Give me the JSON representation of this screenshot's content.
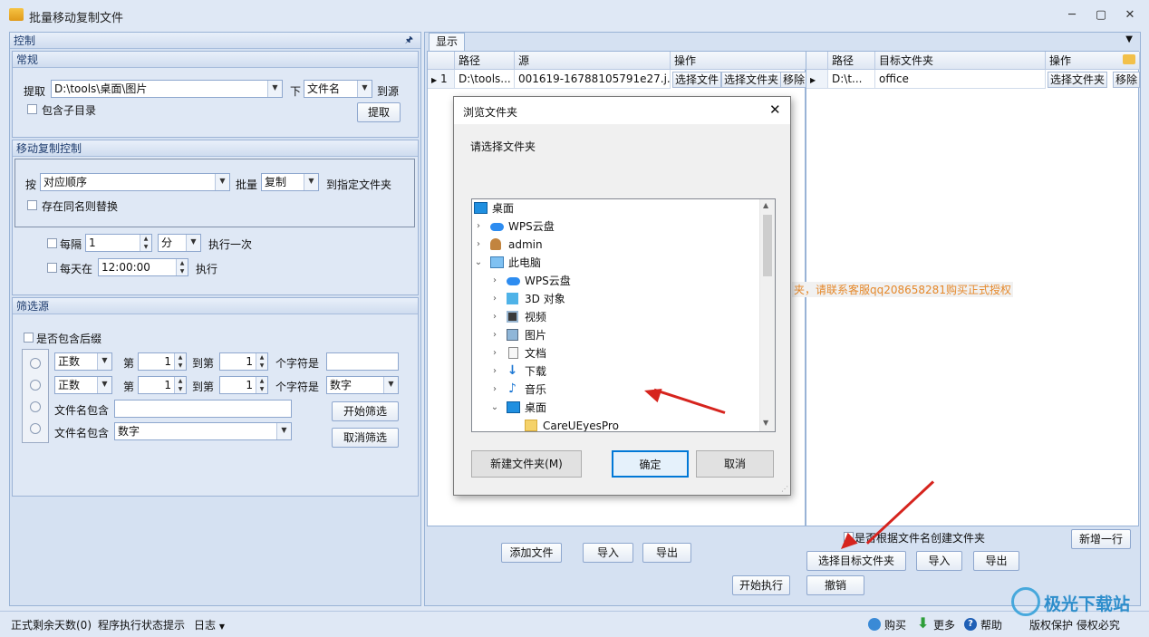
{
  "window": {
    "title": "批量移动复制文件",
    "min": "─",
    "max": "▢",
    "close": "✕"
  },
  "left": {
    "panel_title": "控制",
    "pin": "🖈",
    "general": {
      "title": "常规",
      "extract_label": "提取",
      "path_value": "D:\\tools\\桌面\\图片",
      "under_label": "下",
      "type_value": "文件名",
      "to_source_label": "到源",
      "include_subdir": "包含子目录",
      "extract_button": "提取"
    },
    "move": {
      "title": "移动复制控制",
      "by_label": "按",
      "order_value": "对应顺序",
      "batch_label": "批量",
      "op_value": "复制",
      "to_folder_label": "到指定文件夹",
      "replace_label": "存在同名则替换",
      "every_label": "每隔",
      "every_value": "1",
      "unit_value": "分",
      "exec_once_label": "执行一次",
      "daily_label": "每天在",
      "time_value": "12:00:00",
      "exec_label": "执行"
    },
    "filter": {
      "title": "筛选源",
      "suffix_label": "是否包含后缀",
      "row1": {
        "mode": "正数",
        "di": "第",
        "from": "1",
        "to_label": "到第",
        "to": "1",
        "chars_label": "个字符是",
        "value": ""
      },
      "row2": {
        "mode": "正数",
        "di": "第",
        "from": "1",
        "to_label": "到第",
        "to": "1",
        "chars_label": "个字符是",
        "value": "数字"
      },
      "name_contains_label": "文件名包含",
      "name_contains_value": "",
      "name_contains2_label": "文件名包含",
      "name_contains2_value": "数字",
      "start_filter": "开始筛选",
      "cancel_filter": "取消筛选"
    }
  },
  "right": {
    "tab": "显示",
    "grid_left": {
      "headers": [
        "路径",
        "源",
        "操作"
      ],
      "row_num": "1",
      "path": "D:\\tools...",
      "source": "001619-16788105791e27.j...",
      "btn_select_file": "选择文件",
      "btn_select_folder": "选择文件夹",
      "btn_remove": "移除"
    },
    "grid_right": {
      "headers": [
        "路径",
        "目标文件夹",
        "操作"
      ],
      "path": "D:\\t...",
      "target": "office",
      "btn_select_folder": "选择文件夹",
      "btn_remove": "移除"
    },
    "license_notice": "夹，请联系客服qq208658281购买正式授权",
    "create_by_name": "是否根据文件名创建文件夹",
    "add_row": "新增一行",
    "add_file": "添加文件",
    "import1": "导入",
    "export1": "导出",
    "select_target": "选择目标文件夹",
    "import2": "导入",
    "export2": "导出",
    "start_exec": "开始执行",
    "undo": "撤销"
  },
  "dialog": {
    "title": "浏览文件夹",
    "prompt": "请选择文件夹",
    "tree": [
      {
        "label": "桌面",
        "icon": "desktop-icon"
      },
      {
        "label": "WPS云盘",
        "icon": "cloud-icon"
      },
      {
        "label": "admin",
        "icon": "user-icon"
      },
      {
        "label": "此电脑",
        "icon": "computer-icon"
      },
      {
        "label": "WPS云盘",
        "icon": "cloud-icon"
      },
      {
        "label": "3D 对象",
        "icon": "cube-icon"
      },
      {
        "label": "视频",
        "icon": "video-icon"
      },
      {
        "label": "图片",
        "icon": "picture-icon"
      },
      {
        "label": "文档",
        "icon": "document-icon"
      },
      {
        "label": "下载",
        "icon": "download-icon"
      },
      {
        "label": "音乐",
        "icon": "music-icon"
      },
      {
        "label": "桌面",
        "icon": "desktop-icon"
      },
      {
        "label": "CareUEyesPro",
        "icon": "folder-icon"
      }
    ],
    "new_folder": "新建文件夹(M)",
    "ok": "确定",
    "cancel": "取消"
  },
  "status": {
    "days_left": "正式剩余天数(0)",
    "exec_hint": "程序执行状态提示",
    "log": "日志",
    "buy": "购买",
    "more": "更多",
    "help": "帮助",
    "copyright": "版权保护 侵权必究"
  },
  "watermark": "极光下载站",
  "colors": {
    "accent": "#1e3c6e",
    "notice": "#e5882a",
    "arrow": "#d6241e"
  }
}
